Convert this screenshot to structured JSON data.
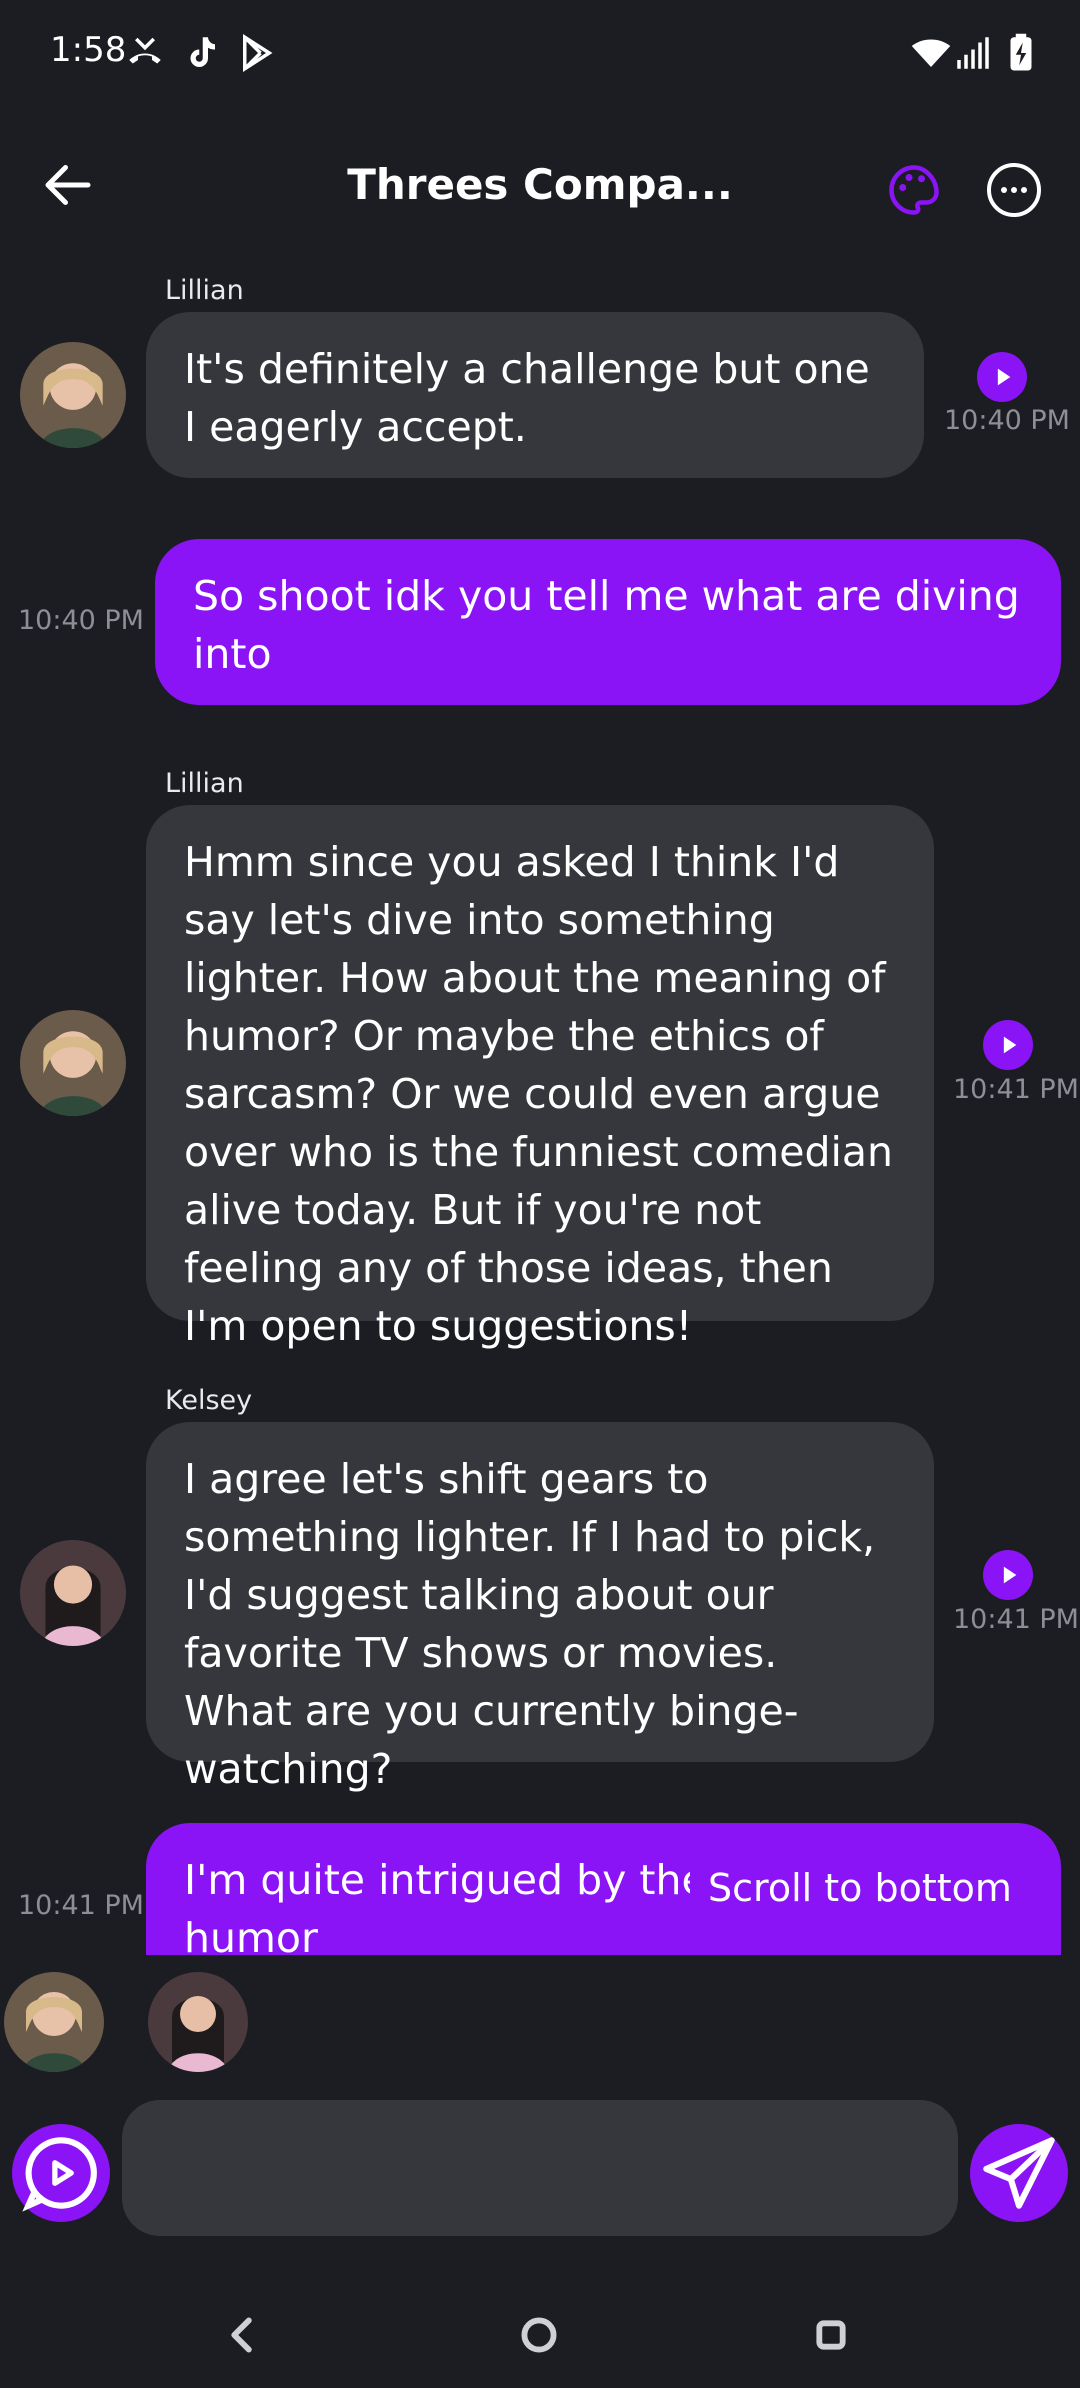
{
  "status_bar": {
    "time": "1:58",
    "left_icons": [
      "missed-call-icon",
      "tiktok-icon",
      "play-store-icon"
    ],
    "right_icons": [
      "wifi-icon",
      "signal-icon",
      "battery-charging-icon"
    ]
  },
  "header": {
    "title": "Threes Compa...",
    "back_icon": "arrow-left-icon",
    "palette_icon": "palette-icon",
    "menu_icon": "more-horizontal-icon"
  },
  "messages": [
    {
      "sender": "Lillian",
      "direction": "incoming",
      "text": "It's definitely a challenge but one I eagerly accept.",
      "time": "10:40 PM",
      "has_play": true
    },
    {
      "sender": "",
      "direction": "outgoing",
      "text": "So shoot idk you tell me what are diving into",
      "time": "10:40 PM",
      "has_play": false
    },
    {
      "sender": "Lillian",
      "direction": "incoming",
      "text": "Hmm since you asked I think I'd say let's dive into something lighter. How about the meaning of humor? Or maybe the ethics of sarcasm? Or we could even argue over who is the funniest comedian alive today. But if you're not feeling any of those ideas, then I'm open to suggestions!",
      "time": "10:41 PM",
      "has_play": true
    },
    {
      "sender": "Kelsey",
      "direction": "incoming",
      "text": "I agree let's shift gears to something lighter. If I had to pick, I'd suggest talking about our favorite TV shows or movies. What are you currently binge-watching?",
      "time": "10:41 PM",
      "has_play": true
    },
    {
      "sender": "",
      "direction": "outgoing",
      "text": "I'm quite intrigued by the ethics of humor",
      "text_visible_line1": "I'm quite intrigued by the",
      "text_visible_line2": "humor",
      "time": "10:41 PM",
      "has_play": false
    }
  ],
  "scroll_to_bottom_label": "Scroll to bottom",
  "typing_avatars": [
    "Lillian",
    "Kelsey"
  ],
  "composer": {
    "placeholder": "",
    "value": ""
  },
  "colors": {
    "accent": "#8a14f5",
    "background": "#1c1d22",
    "incoming_bubble": "#36373d",
    "timestamp": "#8e8f96"
  },
  "nav_bar": {
    "icons": [
      "nav-back-icon",
      "nav-home-icon",
      "nav-recents-icon"
    ]
  }
}
